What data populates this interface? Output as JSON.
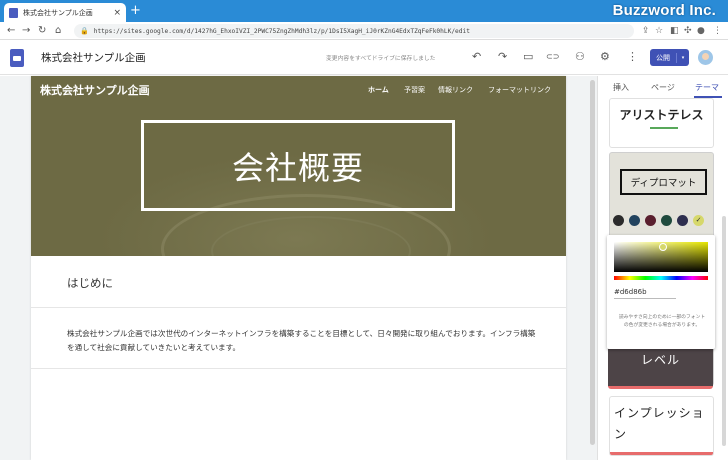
{
  "browser": {
    "tab_title": "株式会社サンプル企画",
    "tab_close": "×",
    "new_tab": "+",
    "url": "https://sites.google.com/d/1427hG_EhxoIVZI_2PWC75ZngZhMdh3lz/p/1DsI5XagH_iJ0rKZnG4EdxTZqFeFk0hLK/edit",
    "nav_back": "←",
    "nav_forward": "→",
    "nav_reload": "↻",
    "nav_home": "⌂",
    "lock": "🔒"
  },
  "watermark": "Buzzword Inc.",
  "editor": {
    "site_name": "株式会社サンプル企画",
    "save_status": "変更内容をすべてドライブに保存しました",
    "publish_label": "公開",
    "publish_chevron": "▾",
    "toolbar_icons": [
      "undo-icon",
      "redo-icon",
      "preview-icon",
      "link-icon",
      "share-icon",
      "settings-icon",
      "more-icon"
    ]
  },
  "toolbar_glyphs": {
    "undo": "↶",
    "redo": "↷",
    "preview": "▭",
    "link": "⊂⊃",
    "share": "⚇",
    "settings": "⚙",
    "more": "⋮"
  },
  "site": {
    "logo_text": "株式会社サンプル企画",
    "nav": [
      "ホーム",
      "予習案",
      "情報リンク",
      "フォーマットリンク"
    ],
    "hero_title": "会社概要",
    "section_heading": "はじめに",
    "paragraph": "株式会社サンプル企画では次世代のインターネットインフラを構築することを目標として、日々開発に取り組んでおります。インフラ構築を通して社会に貢献していきたいと考えています。"
  },
  "panel": {
    "tabs": [
      "挿入",
      "ページ",
      "テーマ"
    ],
    "active_tab": "テーマ",
    "themes": {
      "aristotle": "アリストテレス",
      "diplomat": "ディプロマット",
      "level": "レベル",
      "impression": "インプレッション"
    },
    "swatches": [
      "#2b2b2b",
      "#22435e",
      "#5a1f2e",
      "#1f4a3d",
      "#2e2f4f"
    ],
    "selected_swatch": "#d6d86b",
    "picker": {
      "hex_value": "#d6d86b",
      "note": "読みやすさ向上のために一部のフォントの色が変更される場合があります。"
    }
  },
  "colors": {
    "browser_bar": "#2a8bd6",
    "hero_bg": "#6d6a44",
    "accent": "#3f51b5",
    "level_card": "#4d4447"
  }
}
